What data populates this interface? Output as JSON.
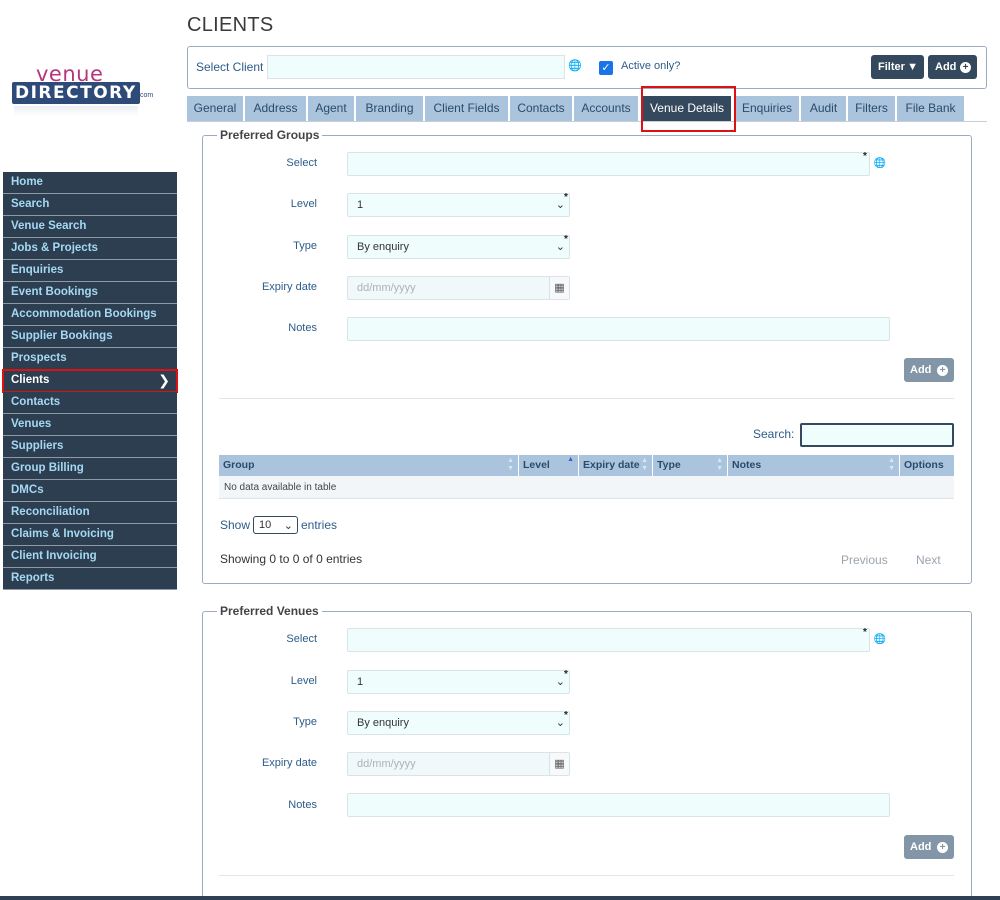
{
  "logo": {
    "top": "venue",
    "bottom": "DIRECTORY",
    "suffix": ".com"
  },
  "sidebar": {
    "items": [
      {
        "label": "Home"
      },
      {
        "label": "Search"
      },
      {
        "label": "Venue Search"
      },
      {
        "label": "Jobs & Projects"
      },
      {
        "label": "Enquiries"
      },
      {
        "label": "Event Bookings"
      },
      {
        "label": "Accommodation Bookings"
      },
      {
        "label": "Supplier Bookings"
      },
      {
        "label": "Prospects"
      },
      {
        "label": "Clients",
        "active": true
      },
      {
        "label": "Contacts"
      },
      {
        "label": "Venues"
      },
      {
        "label": "Suppliers"
      },
      {
        "label": "Group Billing"
      },
      {
        "label": "DMCs"
      },
      {
        "label": "Reconciliation"
      },
      {
        "label": "Claims & Invoicing"
      },
      {
        "label": "Client Invoicing"
      },
      {
        "label": "Reports"
      }
    ]
  },
  "header": {
    "title": "CLIENTS",
    "select_client_label": "Select Client",
    "select_client_value": "",
    "active_only_label": "Active only?",
    "active_only_checked": true,
    "filter_label": "Filter",
    "add_label": "Add"
  },
  "tabs": [
    {
      "label": "General"
    },
    {
      "label": "Address"
    },
    {
      "label": "Agent"
    },
    {
      "label": "Branding"
    },
    {
      "label": "Client Fields"
    },
    {
      "label": "Contacts"
    },
    {
      "label": "Accounts"
    },
    {
      "label": "Venue Details",
      "active": true
    },
    {
      "label": "Enquiries"
    },
    {
      "label": "Audit"
    },
    {
      "label": "Filters"
    },
    {
      "label": "File Bank"
    }
  ],
  "preferred_groups": {
    "legend": "Preferred Groups",
    "select_label": "Select",
    "level_label": "Level",
    "level_value": "1",
    "type_label": "Type",
    "type_value": "By enquiry",
    "expiry_label": "Expiry date",
    "expiry_placeholder": "dd/mm/yyyy",
    "notes_label": "Notes",
    "add_label": "Add",
    "table": {
      "search_label": "Search:",
      "columns": [
        "Group",
        "Level",
        "Expiry date",
        "Type",
        "Notes",
        "Options"
      ],
      "empty_text": "No data available in table",
      "show_label": "Show",
      "page_length": "10",
      "entries_label": "entries",
      "info": "Showing 0 to 0 of 0 entries",
      "previous": "Previous",
      "next": "Next"
    }
  },
  "preferred_venues": {
    "legend": "Preferred Venues",
    "select_label": "Select",
    "level_label": "Level",
    "level_value": "1",
    "type_label": "Type",
    "type_value": "By enquiry",
    "expiry_label": "Expiry date",
    "expiry_placeholder": "dd/mm/yyyy",
    "notes_label": "Notes",
    "add_label": "Add"
  },
  "colors": {
    "nav_bg": "#2c3e50",
    "nav_text": "#a5d8f3",
    "tab_bg": "#a9c4dc",
    "tab_active_bg": "#34495e",
    "highlight": "#dd1111"
  }
}
